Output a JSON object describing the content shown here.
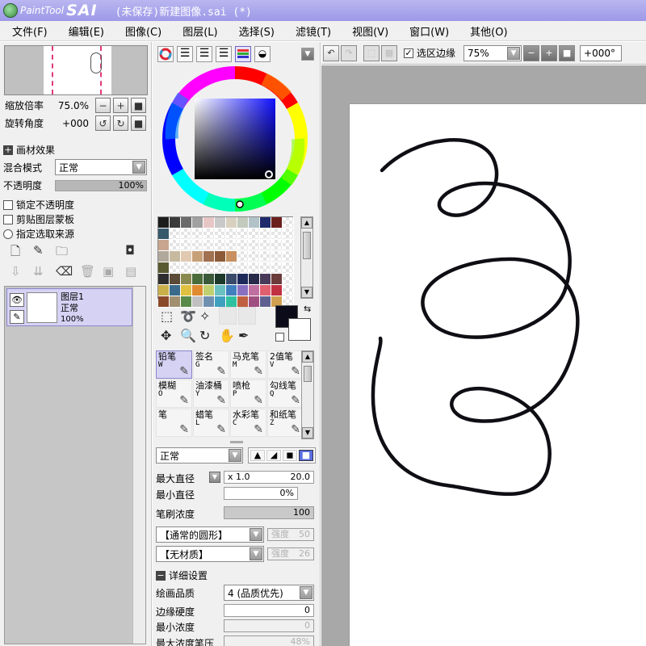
{
  "titlebar": {
    "logo_small": "PaintTool",
    "logo_big": "SAI",
    "title": "(未保存)新建图像.sai (*)"
  },
  "menubar": {
    "items": [
      "文件(F)",
      "编辑(E)",
      "图像(C)",
      "图层(L)",
      "选择(S)",
      "滤镜(T)",
      "视图(V)",
      "窗口(W)",
      "其他(O)"
    ]
  },
  "navigator": {
    "zoom_label": "缩放倍率",
    "zoom_value": "75.0%",
    "rotate_label": "旋转角度",
    "rotate_value": "+000"
  },
  "layer_panel": {
    "effects_label": "画材效果",
    "blend_label": "混合模式",
    "blend_value": "正常",
    "opacity_label": "不透明度",
    "opacity_value": "100%",
    "opacity_fraction": 1.0,
    "lock_opacity_label": "锁定不透明度",
    "clip_mask_label": "剪贴图层蒙板",
    "selection_source_label": "指定选取来源",
    "layers": [
      {
        "name": "图层1",
        "mode": "正常",
        "opacity": "100%"
      }
    ]
  },
  "palette": {
    "swatches": [
      "#1c1c1c",
      "#3a3a3a",
      "#6b6b6b",
      "#a0a0a0",
      "#e8c6c6",
      "#c9c9c9",
      "#d9d1c0",
      "#c2c9bd",
      "#b2c2c9",
      "#1e2a6b",
      "#6b1e1e",
      "",
      "#365a6b",
      "",
      "",
      "",
      "",
      "",
      "",
      "",
      "",
      "",
      "",
      "",
      "#c9a58f",
      "",
      "",
      "",
      "",
      "",
      "",
      "",
      "",
      "",
      "",
      "",
      "#b0a89a",
      "#c8baa0",
      "#e0c9b0",
      "#c8a078",
      "#a07050",
      "#8c5a38",
      "#c89060",
      "",
      "",
      "",
      "",
      "",
      "#5a5a30",
      "",
      "",
      "",
      "",
      "",
      "",
      "",
      "",
      "",
      "",
      "",
      "#2e2e2e",
      "#5b4a35",
      "#8a8a50",
      "#4a6b3a",
      "#3a5a3a",
      "#1e3a2a",
      "#3a4a6b",
      "#1e2a5a",
      "#2a2a4a",
      "#4a3a5a",
      "#6b3a3a",
      "",
      "#c9b04a",
      "#3a6b8a",
      "#e0c040",
      "#e08a30",
      "#c0d070",
      "#6bc0c0",
      "#4080c0",
      "#8a70c0",
      "#c070a0",
      "#e06070",
      "#c03040",
      "",
      "#8a4a2a",
      "#a09070",
      "#5a8a4a",
      "#c0c0c0",
      "#7090b0",
      "#40a0c0",
      "#30c0a0",
      "#c06040",
      "#a05080",
      "#606090",
      "#d0a050",
      ""
    ]
  },
  "tools": {
    "foreground_color": "#0b0b1a",
    "background_color": "#ffffff"
  },
  "brushes": [
    {
      "name": "铅笔",
      "key": "W",
      "active": true
    },
    {
      "name": "签名",
      "key": "G",
      "active": false
    },
    {
      "name": "马克笔",
      "key": "M",
      "active": false
    },
    {
      "name": "2值笔",
      "key": "V",
      "active": false
    },
    {
      "name": "模糊",
      "key": "O",
      "active": false
    },
    {
      "name": "油漆桶",
      "key": "Y",
      "active": false
    },
    {
      "name": "喷枪",
      "key": "P",
      "active": false
    },
    {
      "name": "勾线笔",
      "key": "Q",
      "active": false
    },
    {
      "name": "笔",
      "key": "",
      "active": false
    },
    {
      "name": "蜡笔",
      "key": "L",
      "active": false
    },
    {
      "name": "水彩笔",
      "key": "C",
      "active": false
    },
    {
      "name": "和纸笔",
      "key": "Z",
      "active": false
    }
  ],
  "brush_settings": {
    "mode_value": "正常",
    "max_size_label": "最大直径",
    "size_multiplier": "x 1.0",
    "max_size_value": "20.0",
    "min_size_label": "最小直径",
    "min_size_value": "0%",
    "density_label": "笔刷浓度",
    "density_value": "100",
    "shape_value": "【通常的圆形】",
    "shape_strength_label": "强度",
    "shape_strength_value": "50",
    "texture_value": "【无材质】",
    "texture_strength_label": "强度",
    "texture_strength_value": "26",
    "details_label": "详细设置",
    "quality_label": "绘画品质",
    "quality_value": "4 (品质优先)",
    "edge_hardness_label": "边缘硬度",
    "edge_hardness_value": "0",
    "min_density_label": "最小浓度",
    "min_density_value": "0",
    "max_density_pressure_label": "最大浓度笔压",
    "max_density_pressure_value": "48%"
  },
  "canvas_toolbar": {
    "selection_edge_label": "选区边缘",
    "zoom_value": "75%",
    "rotate_value": "+000°"
  }
}
